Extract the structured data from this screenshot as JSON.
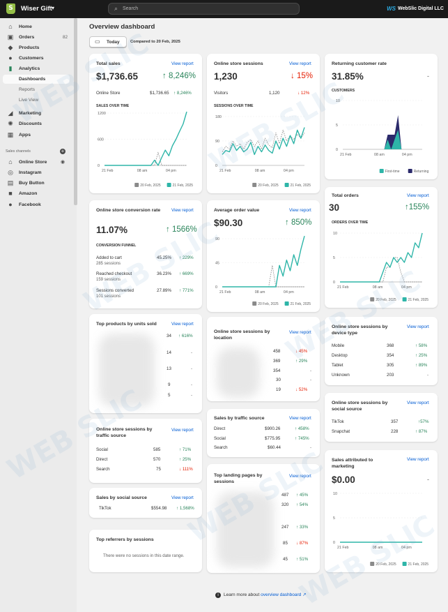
{
  "topbar": {
    "store_name": "Wiser Gift",
    "search_placeholder": "Search",
    "account_logo": "WS",
    "account_name": "WebSlic Digital LLC"
  },
  "sidebar": {
    "items": [
      {
        "label": "Home",
        "icon": "home-icon"
      },
      {
        "label": "Orders",
        "icon": "orders-icon",
        "badge": "82"
      },
      {
        "label": "Products",
        "icon": "tag-icon"
      },
      {
        "label": "Customers",
        "icon": "person-icon"
      },
      {
        "label": "Analytics",
        "icon": "bar-chart-icon"
      }
    ],
    "analytics_sub": [
      "Dashboards",
      "Reports",
      "Live View"
    ],
    "items2": [
      {
        "label": "Marketing",
        "icon": "megaphone-icon"
      },
      {
        "label": "Discounts",
        "icon": "discount-icon"
      },
      {
        "label": "Apps",
        "icon": "apps-icon"
      }
    ],
    "sales_channels_label": "Sales channels",
    "channels": [
      {
        "label": "Online Store",
        "icon": "store-icon"
      },
      {
        "label": "Instagram",
        "icon": "instagram-icon"
      },
      {
        "label": "Buy Button",
        "icon": "buy-button-icon"
      },
      {
        "label": "Amazon",
        "icon": "amazon-icon"
      },
      {
        "label": "Facebook",
        "icon": "facebook-icon"
      }
    ]
  },
  "page": {
    "title": "Overview dashboard",
    "date_button": "Today",
    "compared": "Compared to 20 Feb, 2025",
    "view_report": "View report",
    "footer_prefix": "Learn more about ",
    "footer_link": "overview dashboard"
  },
  "colors": {
    "accent": "#2eb5a8",
    "navy": "#2b2a6b",
    "up": "#29845a",
    "down": "#e51c00",
    "link": "#005bd3"
  },
  "cards": {
    "total_sales": {
      "title": "Total sales",
      "value": "$1,736.65",
      "change": "↑ 8,246%",
      "row_label": "Online Store",
      "row_value": "$1,736.65",
      "row_change": "↑ 8,246%",
      "chart_label": "SALES OVER TIME"
    },
    "sessions": {
      "title": "Online store sessions",
      "value": "1,230",
      "change": "↓ 15%",
      "row_label": "Visitors",
      "row_value": "1,120",
      "row_change": "↓ 12%",
      "chart_label": "SESSIONS OVER TIME"
    },
    "returning": {
      "title": "Returning customer rate",
      "value": "31.85%",
      "change": "-",
      "chart_label": "CUSTOMERS"
    },
    "conversion": {
      "title": "Online store conversion rate",
      "value": "11.07%",
      "change": "↑ 1566%",
      "funnel_label": "CONVERSION FUNNEL",
      "rows": [
        {
          "label": "Added to cart",
          "sub": "285 sessions",
          "pct": "45.25%",
          "chg": "↑ 229%"
        },
        {
          "label": "Reached checkout",
          "sub": "159 sessions",
          "pct": "36.23%",
          "chg": "↑ 669%"
        },
        {
          "label": "Sessions converted",
          "sub": "101 sessions",
          "pct": "27.89%",
          "chg": "↑ 771%"
        }
      ]
    },
    "aov": {
      "title": "Average order value",
      "value": "$90.30",
      "change": "↑ 850%"
    },
    "total_orders": {
      "title": "Total orders",
      "value": "30",
      "change": "↑155%",
      "chart_label": "ORDERS OVER TIME"
    },
    "top_products": {
      "title": "Top products by units sold",
      "rows": [
        {
          "v": "34",
          "c": "↑ 616%"
        },
        {
          "v": "14",
          "c": "-"
        },
        {
          "v": "13",
          "c": "-"
        },
        {
          "v": "9",
          "c": "-"
        },
        {
          "v": "5",
          "c": "-"
        }
      ]
    },
    "sessions_location": {
      "title": "Online store sessions by location",
      "rows": [
        {
          "v": "458",
          "c": "↓ 45%"
        },
        {
          "v": "369",
          "c": "↑ 29%"
        },
        {
          "v": "354",
          "c": "-"
        },
        {
          "v": "30",
          "c": "-"
        },
        {
          "v": "19",
          "c": "↓ 52%"
        }
      ]
    },
    "device": {
      "title": "Online store sessions by device type",
      "rows": [
        {
          "label": "Mobile",
          "v": "368",
          "c": "↑ 58%"
        },
        {
          "label": "Desktop",
          "v": "354",
          "c": "↑ 25%"
        },
        {
          "label": "Tablet",
          "v": "305",
          "c": "↑ 89%"
        },
        {
          "label": "Unknown",
          "v": "203",
          "c": "-"
        }
      ]
    },
    "traffic_source_sessions": {
      "title": "Online store sessions by traffic source",
      "rows": [
        {
          "label": "Social",
          "v": "585",
          "c": "↑ 71%"
        },
        {
          "label": "Direct",
          "v": "570",
          "c": "↑ 25%"
        },
        {
          "label": "Search",
          "v": "75",
          "c": "↓ 111%"
        }
      ]
    },
    "sales_traffic": {
      "title": "Sales by traffic source",
      "rows": [
        {
          "label": "Direct",
          "v": "$900.26",
          "c": "↑ 458%"
        },
        {
          "label": "Social",
          "v": "$775.95",
          "c": "↑ 745%"
        },
        {
          "label": "Search",
          "v": "$60.44",
          "c": "-"
        }
      ]
    },
    "social_source": {
      "title": "Online store sessions by social source",
      "rows": [
        {
          "label": "TikTok",
          "v": "357",
          "c": "↑57%"
        },
        {
          "label": "Snapchat",
          "v": "228",
          "c": "↑ 87%"
        }
      ]
    },
    "sales_social": {
      "title": "Sales by social source",
      "row_label": "TikTok",
      "row_value": "$554.98",
      "row_change": "↑ 1,568%"
    },
    "landing_pages": {
      "title": "Top landing pages by sessions",
      "rows": [
        {
          "v": "487",
          "c": "↑ 45%"
        },
        {
          "v": "320",
          "c": "↑ 54%"
        },
        {
          "v": "247",
          "c": "↑ 33%"
        },
        {
          "v": "85",
          "c": "↓ 87%"
        },
        {
          "v": "45",
          "c": "↑ 51%"
        }
      ]
    },
    "referrers": {
      "title": "Top referrers by sessions",
      "empty": "There were no sessions in this date range."
    },
    "sales_marketing": {
      "title": "Sales attributed to marketing",
      "value": "$0.00",
      "change": "-"
    }
  },
  "chart_data": [
    {
      "type": "line",
      "title": "SALES OVER TIME",
      "x_ticks": [
        "21 Feb",
        "08 am",
        "04 pm"
      ],
      "y_ticks": [
        "0",
        "600",
        "1200"
      ],
      "ylim": [
        0,
        1200
      ],
      "x": [
        0,
        1,
        2,
        3,
        4,
        5,
        6,
        7,
        8,
        9,
        10,
        11,
        12,
        13,
        14,
        15,
        16,
        17,
        18,
        19,
        20,
        21,
        22,
        23
      ],
      "series": [
        {
          "name": "21 Feb, 2025",
          "color": "#2eb5a8",
          "style": "solid",
          "values": [
            0,
            0,
            0,
            0,
            0,
            0,
            0,
            0,
            0,
            0,
            0,
            0,
            0,
            0,
            120,
            0,
            180,
            350,
            220,
            450,
            600,
            780,
            950,
            1230
          ]
        },
        {
          "name": "20 Feb, 2025",
          "color": "#8a8a8a",
          "style": "dotted",
          "values": [
            0,
            0,
            0,
            0,
            0,
            0,
            0,
            0,
            0,
            0,
            0,
            0,
            0,
            0,
            0,
            300,
            0,
            0,
            0,
            0,
            0,
            0,
            0,
            0
          ]
        }
      ]
    },
    {
      "type": "line",
      "title": "SESSIONS OVER TIME",
      "x_ticks": [
        "21 Feb",
        "08 am",
        "04 pm"
      ],
      "y_ticks": [
        "0",
        "90",
        "180"
      ],
      "ylim": [
        0,
        180
      ],
      "x": [
        0,
        1,
        2,
        3,
        4,
        5,
        6,
        7,
        8,
        9,
        10,
        11,
        12,
        13,
        14,
        15,
        16,
        17,
        18,
        19,
        20,
        21,
        22,
        23
      ],
      "series": [
        {
          "name": "21 Feb, 2025",
          "color": "#2eb5a8",
          "style": "solid",
          "values": [
            40,
            55,
            50,
            80,
            55,
            70,
            50,
            60,
            85,
            40,
            70,
            50,
            75,
            55,
            45,
            90,
            60,
            100,
            70,
            110,
            80,
            130,
            100,
            140
          ]
        },
        {
          "name": "20 Feb, 2025",
          "color": "#8a8a8a",
          "style": "dotted",
          "values": [
            50,
            70,
            60,
            90,
            70,
            80,
            60,
            85,
            95,
            70,
            90,
            60,
            100,
            75,
            65,
            120,
            80,
            130,
            90,
            110,
            95,
            115,
            100,
            120
          ]
        }
      ]
    },
    {
      "type": "area",
      "title": "CUSTOMERS",
      "x_ticks": [
        "21 Feb",
        "08 am",
        "04 pm"
      ],
      "y_ticks": [
        "0",
        "5",
        "10"
      ],
      "ylim": [
        0,
        10
      ],
      "x": [
        0,
        1,
        2,
        3,
        4,
        5,
        6,
        7,
        8,
        9,
        10,
        11,
        12,
        13,
        14,
        15,
        16,
        17,
        18,
        19,
        20,
        21,
        22,
        23
      ],
      "series": [
        {
          "name": "First-time",
          "color": "#2eb5a8",
          "values": [
            0,
            0,
            0,
            0,
            0,
            0,
            0,
            0,
            0,
            0,
            0,
            0,
            0,
            2,
            0,
            2,
            4,
            0,
            0,
            0,
            0,
            0,
            0,
            0
          ]
        },
        {
          "name": "Returning",
          "color": "#2b2a6b",
          "values": [
            0,
            0,
            0,
            0,
            0,
            0,
            0,
            0,
            0,
            0,
            0,
            0,
            0,
            1,
            3,
            1,
            3,
            0,
            0,
            0,
            0,
            0,
            0,
            0
          ]
        }
      ]
    },
    {
      "type": "line",
      "title": "Average order value",
      "x_ticks": [
        "21 Feb",
        "08 am",
        "04 pm"
      ],
      "y_ticks": [
        "0",
        "45",
        "90"
      ],
      "ylim": [
        0,
        90
      ],
      "x": [
        0,
        1,
        2,
        3,
        4,
        5,
        6,
        7,
        8,
        9,
        10,
        11,
        12,
        13,
        14,
        15,
        16,
        17,
        18,
        19,
        20,
        21,
        22,
        23
      ],
      "series": [
        {
          "name": "21 Feb, 2025",
          "color": "#2eb5a8",
          "style": "solid",
          "values": [
            0,
            0,
            0,
            0,
            0,
            0,
            0,
            0,
            0,
            0,
            0,
            0,
            0,
            0,
            0,
            0,
            40,
            20,
            50,
            30,
            60,
            40,
            70,
            95
          ]
        },
        {
          "name": "20 Feb, 2025",
          "color": "#8a8a8a",
          "style": "dotted",
          "values": [
            0,
            0,
            0,
            0,
            0,
            0,
            0,
            0,
            0,
            0,
            0,
            0,
            0,
            0,
            40,
            0,
            0,
            0,
            0,
            0,
            0,
            0,
            0,
            0
          ]
        }
      ]
    },
    {
      "type": "line",
      "title": "ORDERS OVER TIME",
      "x_ticks": [
        "21 Feb",
        "08 am",
        "04 pm"
      ],
      "y_ticks": [
        "0",
        "5",
        "10"
      ],
      "ylim": [
        0,
        10
      ],
      "x": [
        0,
        1,
        2,
        3,
        4,
        5,
        6,
        7,
        8,
        9,
        10,
        11,
        12,
        13,
        14,
        15,
        16,
        17,
        18,
        19,
        20,
        21,
        22,
        23
      ],
      "series": [
        {
          "name": "21 Feb, 2025",
          "color": "#2eb5a8",
          "style": "solid",
          "values": [
            0,
            0,
            0,
            0,
            0,
            0,
            0,
            0,
            0,
            0,
            0,
            0,
            2,
            4,
            3,
            5,
            4,
            5,
            4,
            6,
            5,
            8,
            7,
            10
          ]
        },
        {
          "name": "20 Feb, 2025",
          "color": "#8a8a8a",
          "style": "dotted",
          "values": [
            0,
            0,
            0,
            0,
            0,
            0,
            0,
            0,
            0,
            0,
            0,
            0,
            0,
            3,
            3,
            5,
            5,
            2,
            0,
            0,
            0,
            0,
            0,
            0
          ]
        }
      ]
    },
    {
      "type": "line",
      "title": "Sales attributed to marketing",
      "x_ticks": [
        "21 Feb",
        "08 am",
        "04 pm"
      ],
      "y_ticks": [
        "0",
        "5",
        "10"
      ],
      "ylim": [
        0,
        10
      ],
      "x": [
        0,
        1,
        2,
        3,
        4,
        5,
        6,
        7,
        8,
        9,
        10,
        11,
        12,
        13,
        14,
        15,
        16,
        17,
        18,
        19,
        20,
        21,
        22,
        23
      ],
      "series": [
        {
          "name": "21 Feb, 2025",
          "color": "#2eb5a8",
          "style": "solid",
          "values": [
            0,
            0,
            0,
            0,
            0,
            0,
            0,
            0,
            0,
            0,
            0,
            0,
            0,
            0,
            0,
            0,
            0,
            0,
            0,
            0,
            0,
            0,
            0,
            0
          ]
        },
        {
          "name": "20 Feb, 2025",
          "color": "#8a8a8a",
          "style": "dotted",
          "values": [
            0,
            0,
            0,
            0,
            0,
            0,
            0,
            0,
            0,
            0,
            0,
            0,
            0,
            0,
            0,
            0,
            0,
            0,
            0,
            0,
            0,
            0,
            0,
            0
          ]
        }
      ]
    }
  ]
}
